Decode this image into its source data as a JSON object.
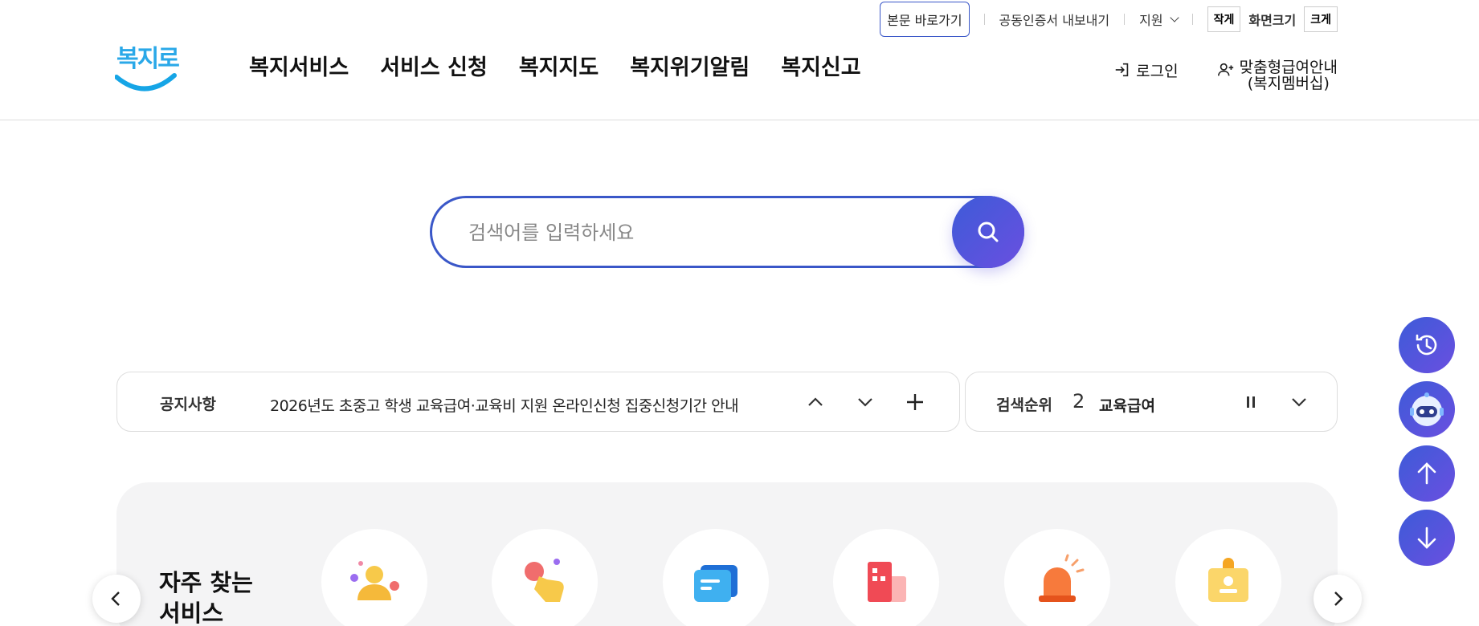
{
  "utility": {
    "skip_label": "본문 바로가기",
    "cert_label": "공동인증서 내보내기",
    "support_label": "지원",
    "small_label": "작게",
    "font_size_label": "화면크기",
    "large_label": "크게"
  },
  "logo": {
    "text": "복지로"
  },
  "nav": {
    "items": [
      "복지서비스",
      "서비스 신청",
      "복지지도",
      "복지위기알림",
      "복지신고"
    ]
  },
  "user_menu": {
    "login_label": "로그인",
    "guide_line1": "맞춤형급여안내",
    "guide_line2": "(복지멤버십)"
  },
  "search": {
    "placeholder": "검색어를 입력하세요",
    "value": ""
  },
  "notice": {
    "label": "공지사항",
    "message": "2026년도 초중고 학생 교육급여·교육비 지원 온라인신청 집중신청기간 안내"
  },
  "ranking": {
    "label": "검색순위",
    "rank": "2",
    "keyword": "교육급여"
  },
  "frequent": {
    "title_line1": "자주 찾는",
    "title_line2": "서비스",
    "icons": [
      "person-icon",
      "touch-hand-icon",
      "message-card-icon",
      "building-icon",
      "alarm-siren-icon",
      "id-badge-icon"
    ]
  },
  "colors": {
    "primary": "#3a57c8",
    "gradient_end": "#6a4fe0",
    "logo": "#2aa8e8"
  }
}
